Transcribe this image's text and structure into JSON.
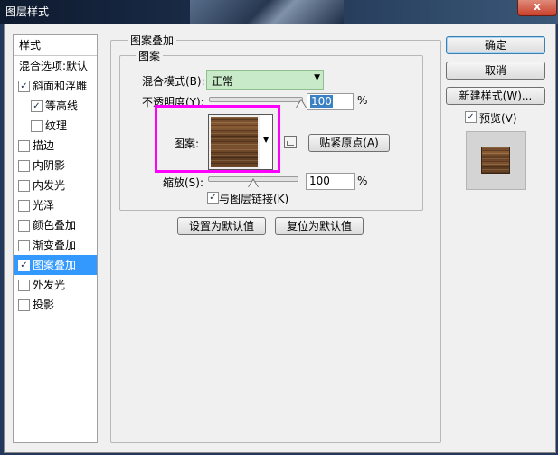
{
  "window": {
    "title": "图层样式",
    "close_label": "x"
  },
  "styles_list": {
    "header": "样式",
    "items": [
      {
        "label": "混合选项:默认",
        "checkbox": false,
        "checked": false,
        "indent": false,
        "selected": false
      },
      {
        "label": "斜面和浮雕",
        "checkbox": true,
        "checked": true,
        "indent": false,
        "selected": false
      },
      {
        "label": "等高线",
        "checkbox": true,
        "checked": true,
        "indent": true,
        "selected": false
      },
      {
        "label": "纹理",
        "checkbox": true,
        "checked": false,
        "indent": true,
        "selected": false
      },
      {
        "label": "描边",
        "checkbox": true,
        "checked": false,
        "indent": false,
        "selected": false
      },
      {
        "label": "内阴影",
        "checkbox": true,
        "checked": false,
        "indent": false,
        "selected": false
      },
      {
        "label": "内发光",
        "checkbox": true,
        "checked": false,
        "indent": false,
        "selected": false
      },
      {
        "label": "光泽",
        "checkbox": true,
        "checked": false,
        "indent": false,
        "selected": false
      },
      {
        "label": "颜色叠加",
        "checkbox": true,
        "checked": false,
        "indent": false,
        "selected": false
      },
      {
        "label": "渐变叠加",
        "checkbox": true,
        "checked": false,
        "indent": false,
        "selected": false
      },
      {
        "label": "图案叠加",
        "checkbox": true,
        "checked": true,
        "indent": false,
        "selected": true
      },
      {
        "label": "外发光",
        "checkbox": true,
        "checked": false,
        "indent": false,
        "selected": false
      },
      {
        "label": "投影",
        "checkbox": true,
        "checked": false,
        "indent": false,
        "selected": false
      }
    ]
  },
  "pattern_overlay": {
    "group_title": "图案叠加",
    "subgroup_title": "图案",
    "blend_mode_label": "混合模式(B):",
    "blend_mode_value": "正常",
    "opacity_label": "不透明度(Y):",
    "opacity_value": "100",
    "opacity_unit": "%",
    "opacity_level": 1.0,
    "pattern_label": "图案:",
    "snap_origin_label": "贴紧原点(A)",
    "scale_label": "缩放(S):",
    "scale_value": "100",
    "scale_unit": "%",
    "link_label": "与图层链接(K)",
    "link_checked": true,
    "make_default_label": "设置为默认值",
    "reset_default_label": "复位为默认值"
  },
  "actions": {
    "ok_label": "确定",
    "cancel_label": "取消",
    "new_style_label": "新建样式(W)...",
    "preview_label": "预览(V)",
    "preview_checked": true
  },
  "icons": {
    "close": "close-icon",
    "checkbox": "checkmark-icon",
    "dropdown": "chevron-down-icon",
    "new_preset": "new-preset-icon",
    "slider": "slider-thumb-icon"
  },
  "colors": {
    "selection": "#3399ff",
    "highlight_outline": "#ff00ff",
    "combo_bg": "#c8eac8",
    "wood_texture": "#6e4829"
  }
}
